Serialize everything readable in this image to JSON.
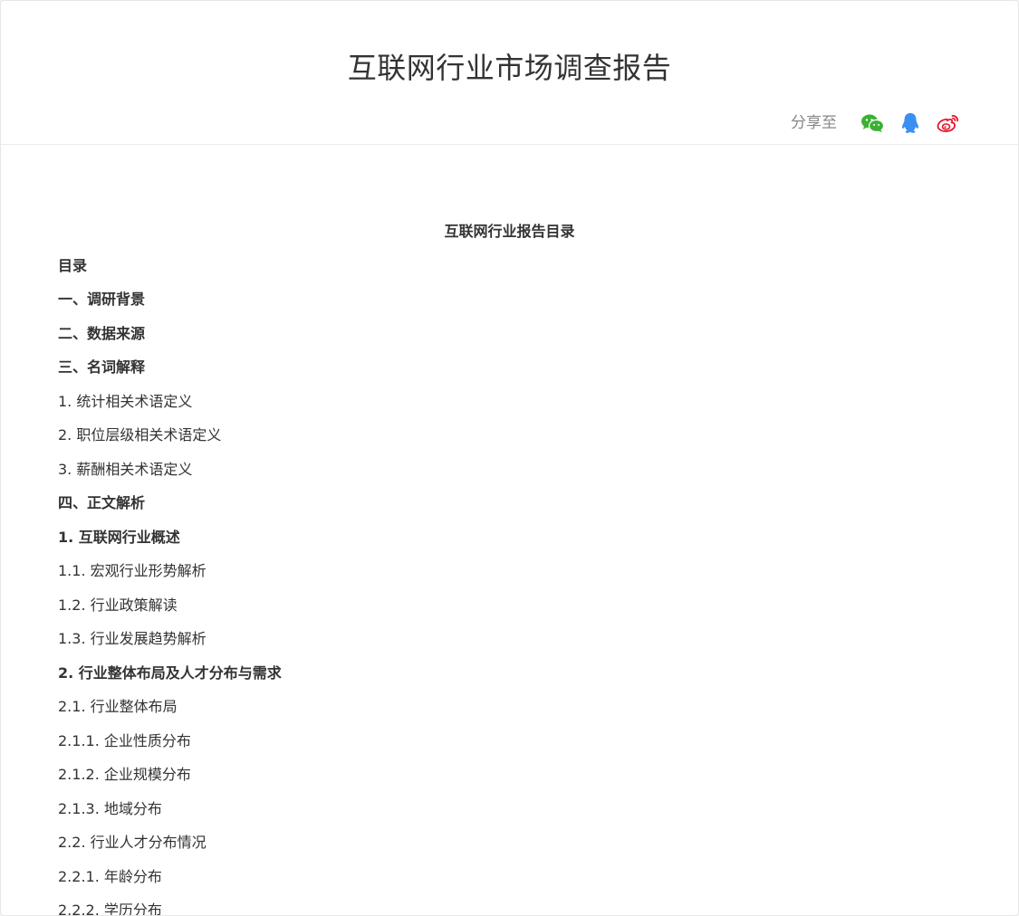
{
  "header": {
    "title": "互联网行业市场调查报告",
    "share_label": "分享至"
  },
  "share_icons": [
    {
      "name": "wechat-icon",
      "color": "#3cb034"
    },
    {
      "name": "qq-icon",
      "color": "#3a8ff2"
    },
    {
      "name": "weibo-icon",
      "color": "#e6162d"
    }
  ],
  "content": {
    "toc_title": "互联网行业报告目录",
    "items": [
      {
        "text": "目录",
        "bold": true
      },
      {
        "text": "一、调研背景",
        "bold": true
      },
      {
        "text": "二、数据来源",
        "bold": true
      },
      {
        "text": "三、名词解释",
        "bold": true
      },
      {
        "text": "1. 统计相关术语定义",
        "bold": false
      },
      {
        "text": "2. 职位层级相关术语定义",
        "bold": false
      },
      {
        "text": "3. 薪酬相关术语定义",
        "bold": false
      },
      {
        "text": "四、正文解析",
        "bold": true
      },
      {
        "text": "1. 互联网行业概述",
        "bold": true
      },
      {
        "text": "1.1. 宏观行业形势解析",
        "bold": false
      },
      {
        "text": "1.2. 行业政策解读",
        "bold": false
      },
      {
        "text": "1.3. 行业发展趋势解析",
        "bold": false
      },
      {
        "text": "2. 行业整体布局及人才分布与需求",
        "bold": true
      },
      {
        "text": "2.1. 行业整体布局",
        "bold": false
      },
      {
        "text": "2.1.1. 企业性质分布",
        "bold": false
      },
      {
        "text": "2.1.2. 企业规模分布",
        "bold": false
      },
      {
        "text": "2.1.3. 地域分布",
        "bold": false
      },
      {
        "text": "2.2. 行业人才分布情况",
        "bold": false
      },
      {
        "text": "2.2.1. 年龄分布",
        "bold": false
      },
      {
        "text": "2.2.2. 学历分布",
        "bold": false
      }
    ]
  }
}
